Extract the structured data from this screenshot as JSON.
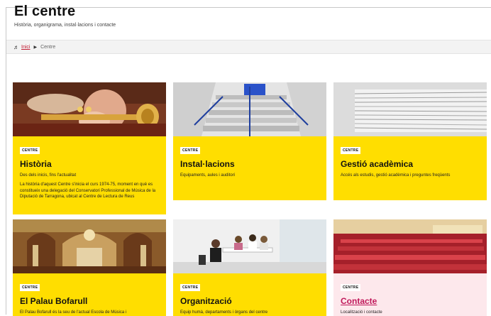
{
  "header": {
    "title": "El centre",
    "subtitle": "Història, organigrama, instal·lacions i contacte"
  },
  "breadcrumb": {
    "home_link": "Inici",
    "current": "Centre"
  },
  "cards": [
    {
      "badge": "CENTRE",
      "title": "Història",
      "lead": "Des dels inicis, fins l'actualitat",
      "description": "La història d'aquest Centre s'inicia el curs 1974-75, moment en què es constitueix una delegació del Conservatori Professional de Música de la Diputació de Tarragona, ubicat al Centre de Lectura de Reus"
    },
    {
      "badge": "CENTRE",
      "title": "Instal·lacions",
      "lead": "Equipaments, aules i auditori"
    },
    {
      "badge": "CENTRE",
      "title": "Gestió acadèmica",
      "lead": "Accés als estudis, gestió acadèmica i preguntes freqüents"
    },
    {
      "badge": "CENTRE",
      "title": "El Palau Bofarull",
      "lead": "El Palau Bofarull és la seu de l'actual Escola de Música i"
    },
    {
      "badge": "CENTRE",
      "title": "Organització",
      "lead": "Equip humà, departaments i òrgans del centre"
    },
    {
      "badge": "CENTRE",
      "title": "Contacte",
      "lead": "Localització i contacte"
    }
  ],
  "colors": {
    "card_yellow": "#ffde00",
    "card_pink": "#fde8ec",
    "link_red": "#c0182f",
    "contact_title": "#c0185a"
  }
}
